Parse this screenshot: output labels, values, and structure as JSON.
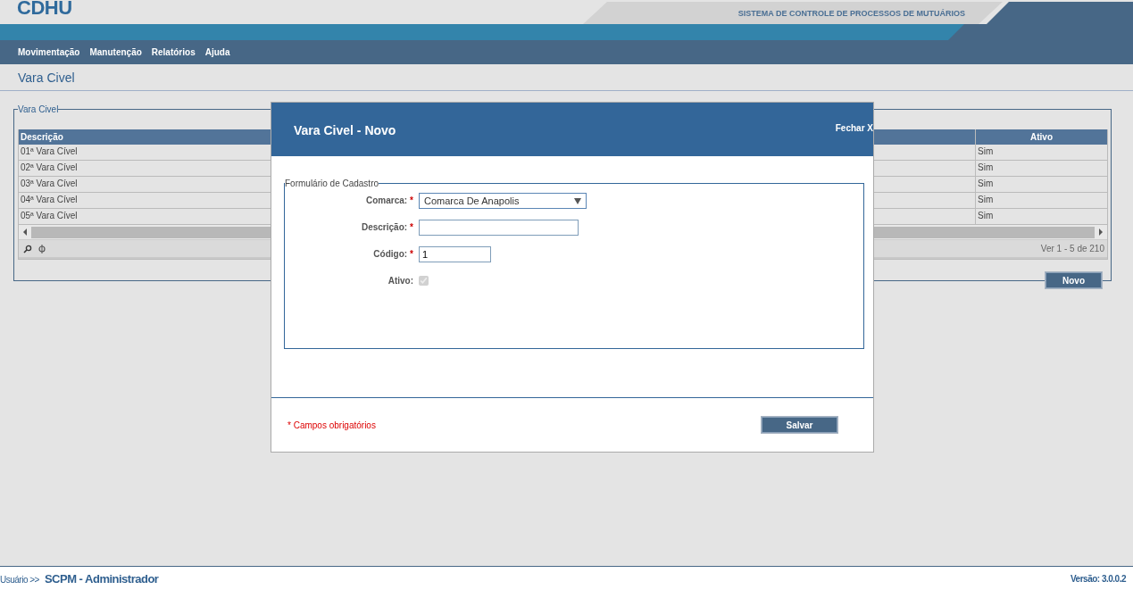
{
  "header": {
    "logo": "CDHU",
    "system_title": "SISTEMA DE CONTROLE DE PROCESSOS DE MUTUÁRIOS"
  },
  "menu": [
    "Movimentação",
    "Manutenção",
    "Relatórios",
    "Ajuda"
  ],
  "page_title": "Vara Civel",
  "panel": {
    "legend": "Vara Civel",
    "table": {
      "columns": [
        "Descrição",
        "Ativo"
      ],
      "rows": [
        {
          "descricao": "01ª Vara Cível",
          "ativo": "Sim"
        },
        {
          "descricao": "02ª Vara Cível",
          "ativo": "Sim"
        },
        {
          "descricao": "03ª Vara Cível",
          "ativo": "Sim"
        },
        {
          "descricao": "04ª Vara Cível",
          "ativo": "Sim"
        },
        {
          "descricao": "05ª Vara Cível",
          "ativo": "Sim"
        }
      ],
      "pager": "Ver 1 - 5 de 210"
    },
    "new_button": "Novo"
  },
  "modal": {
    "title": "Vara Civel - Novo",
    "close": "Fechar X",
    "legend": "Formulário de Cadastro",
    "fields": [
      {
        "kind": "select",
        "label": "Comarca:",
        "mark": "*",
        "value": "Comarca De Anapolis"
      },
      {
        "kind": "text",
        "label": "Descrição:",
        "mark": "*"
      },
      {
        "kind": "code",
        "label": "Código:",
        "mark": "*",
        "value": "1"
      },
      {
        "kind": "checkbox",
        "label": "Ativo:",
        "checked": true,
        "disabled": true
      }
    ],
    "required_note": "* Campos obrigatórios",
    "save_button": "Salvar"
  },
  "footer": {
    "user_label": "Usuário >>",
    "user": "SCPM - Administrador",
    "version": "Versão: 3.0.0.2"
  }
}
